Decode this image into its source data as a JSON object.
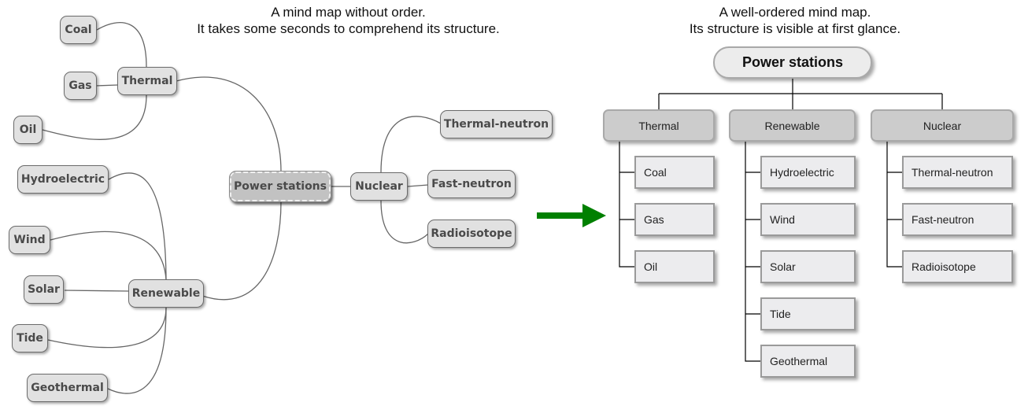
{
  "left_panel": {
    "caption_line1": "A mind map without order.",
    "caption_line2": "It takes some seconds to comprehend its structure.",
    "root": "Power stations",
    "branches": {
      "thermal": {
        "label": "Thermal",
        "children": [
          "Coal",
          "Gas",
          "Oil"
        ]
      },
      "renewable": {
        "label": "Renewable",
        "children": [
          "Hydroelectric",
          "Wind",
          "Solar",
          "Tide",
          "Geothermal"
        ]
      },
      "nuclear": {
        "label": "Nuclear",
        "children": [
          "Thermal-neutron",
          "Fast-neutron",
          "Radioisotope"
        ]
      }
    }
  },
  "arrow": {
    "icon": "right-arrow-icon",
    "color": "#008000"
  },
  "right_panel": {
    "caption_line1": "A well-ordered mind map.",
    "caption_line2": "Its structure is visible at first glance.",
    "root": "Power stations",
    "categories": [
      {
        "label": "Thermal",
        "children": [
          "Coal",
          "Gas",
          "Oil"
        ]
      },
      {
        "label": "Renewable",
        "children": [
          "Hydroelectric",
          "Wind",
          "Solar",
          "Tide",
          "Geothermal"
        ]
      },
      {
        "label": "Nuclear",
        "children": [
          "Thermal-neutron",
          "Fast-neutron",
          "Radioisotope"
        ]
      }
    ]
  },
  "colors": {
    "messy_node_fill": "#e1e1e1",
    "messy_root_fill": "#c2c2c2",
    "ordered_root_fill": "#ececec",
    "ordered_category_fill": "#cccccc",
    "ordered_leaf_fill": "#ececee",
    "connector": "#666666"
  }
}
